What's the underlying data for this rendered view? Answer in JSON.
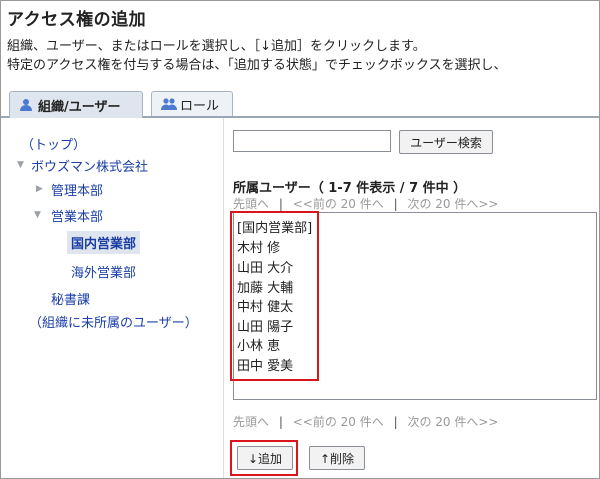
{
  "header": {
    "title": "アクセス権の追加",
    "desc1": "組織、ユーザー、またはロールを選択し、［↓追加］をクリックします。",
    "desc2": "特定のアクセス権を付与する場合は、「追加する状態」でチェックボックスを選択し、"
  },
  "tabs": [
    {
      "label": "組織/ユーザー",
      "active": true
    },
    {
      "label": "ロール",
      "active": false
    }
  ],
  "tree": {
    "top": "（トップ）",
    "company": "ボウズマン株式会社",
    "admin": "管理本部",
    "sales": "営業本部",
    "domestic": "国内営業部",
    "overseas": "海外営業部",
    "secretary": "秘書課",
    "unassigned": "（組織に未所属のユーザー）"
  },
  "search": {
    "button_label": "ユーザー検索",
    "value": ""
  },
  "users_section": {
    "title": "所属ユーザー（ 1-7 件表示 / 7 件中 ）",
    "pager": {
      "first": "先頭へ",
      "sep": "|",
      "prev": "<<前の 20 件へ",
      "next": "次の 20 件へ>>"
    },
    "items": [
      "[国内営業部]",
      "木村 修",
      "山田 大介",
      "加藤 大輔",
      "中村 健太",
      "山田 陽子",
      "小林 恵",
      "田中 愛美"
    ]
  },
  "actions": {
    "add_label": "↓追加",
    "remove_label": "↑削除"
  },
  "colors": {
    "highlight": "#d9161c",
    "link": "#1a3ea6",
    "tab_active_bg": "#dfe5ee"
  }
}
